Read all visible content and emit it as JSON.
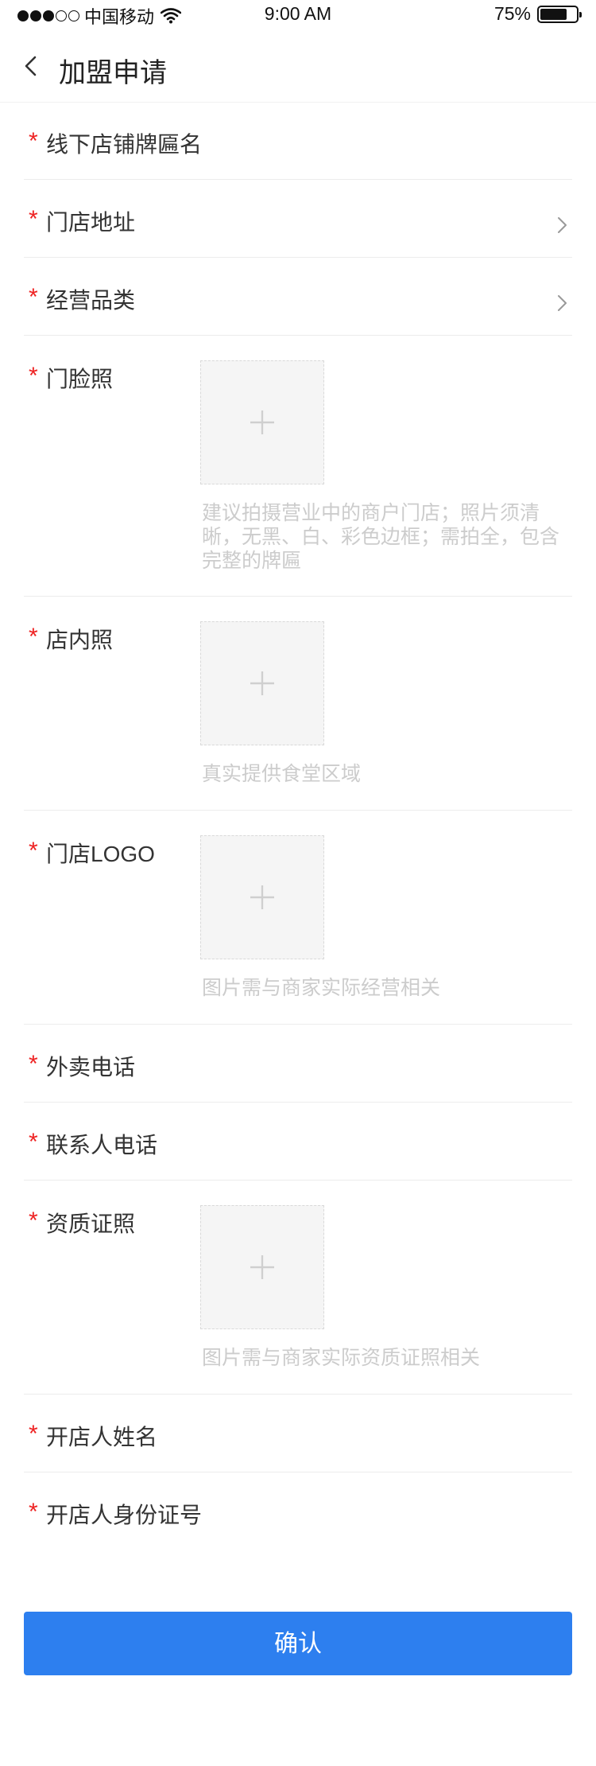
{
  "status_bar": {
    "carrier": "中国移动",
    "time": "9:00 AM",
    "battery_percent": "75%",
    "battery_level": 0.75,
    "signal_bars_filled": 3,
    "signal_bars_total": 5
  },
  "nav": {
    "title": "加盟申请",
    "back_icon": "chevron-left-icon"
  },
  "form": {
    "required_mark": "*",
    "store_sign_name": {
      "label": "线下店铺牌匾名"
    },
    "store_address": {
      "label": "门店地址"
    },
    "business_category": {
      "label": "经营品类"
    },
    "storefront_photo": {
      "label": "门脸照",
      "hint": "建议拍摄营业中的商户门店；照片须清晰，无黑、白、彩色边框；需拍全，包含完整的牌匾"
    },
    "interior_photo": {
      "label": "店内照",
      "hint": "真实提供食堂区域"
    },
    "store_logo": {
      "label": "门店LOGO",
      "hint": "图片需与商家实际经营相关"
    },
    "delivery_phone": {
      "label": "外卖电话"
    },
    "contact_phone": {
      "label": "联系人电话"
    },
    "qualification_license": {
      "label": "资质证照",
      "hint": "图片需与商家实际资质证照相关"
    },
    "owner_name": {
      "label": "开店人姓名"
    },
    "owner_id_number": {
      "label": "开店人身份证号"
    }
  },
  "confirm_button": {
    "label": "确认",
    "color": "#2d7fef"
  },
  "colors": {
    "required": "#ee2222",
    "hint": "#cccccc",
    "divider": "#ececec"
  }
}
